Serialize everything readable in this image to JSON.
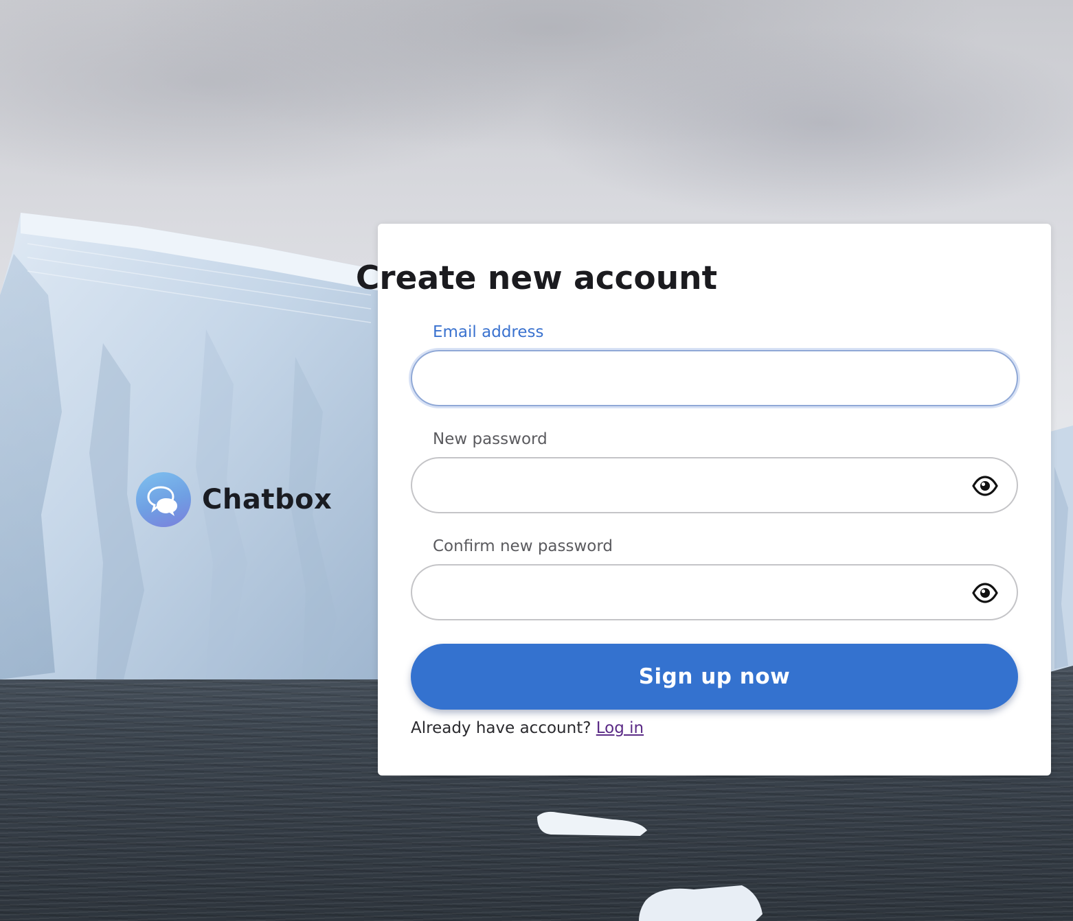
{
  "brand": {
    "name": "Chatbox"
  },
  "form": {
    "title": "Create new account",
    "email": {
      "label": "Email address",
      "value": "",
      "placeholder": ""
    },
    "password": {
      "label": "New password",
      "value": "",
      "placeholder": ""
    },
    "confirm_password": {
      "label": "Confirm new password",
      "value": "",
      "placeholder": ""
    },
    "submit_label": "Sign up now",
    "footer_text": "Already have account?",
    "login_link": "Log in"
  },
  "icons": {
    "logo": "chat-bubbles-icon",
    "password_toggle": "eye-icon",
    "confirm_toggle": "eye-icon"
  },
  "colors": {
    "primary": "#3472cf",
    "focused_label": "#3a72cf",
    "link_visited": "#5a2a86",
    "card_bg": "#ffffff"
  }
}
